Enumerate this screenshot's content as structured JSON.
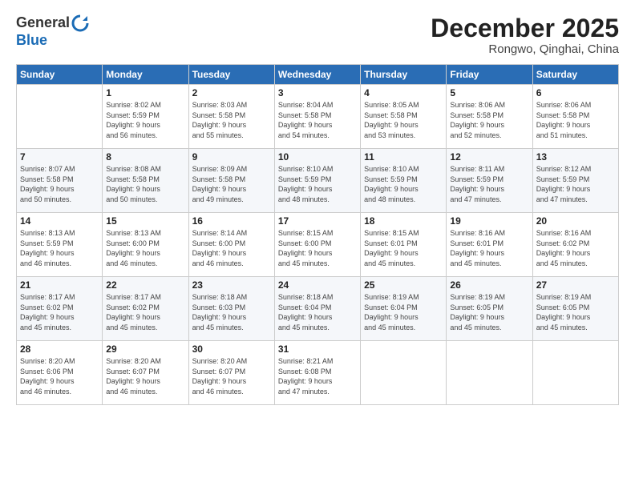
{
  "header": {
    "logo_line1": "General",
    "logo_line2": "Blue",
    "month": "December 2025",
    "location": "Rongwo, Qinghai, China"
  },
  "weekdays": [
    "Sunday",
    "Monday",
    "Tuesday",
    "Wednesday",
    "Thursday",
    "Friday",
    "Saturday"
  ],
  "weeks": [
    [
      {
        "day": "",
        "info": ""
      },
      {
        "day": "1",
        "info": "Sunrise: 8:02 AM\nSunset: 5:59 PM\nDaylight: 9 hours\nand 56 minutes."
      },
      {
        "day": "2",
        "info": "Sunrise: 8:03 AM\nSunset: 5:58 PM\nDaylight: 9 hours\nand 55 minutes."
      },
      {
        "day": "3",
        "info": "Sunrise: 8:04 AM\nSunset: 5:58 PM\nDaylight: 9 hours\nand 54 minutes."
      },
      {
        "day": "4",
        "info": "Sunrise: 8:05 AM\nSunset: 5:58 PM\nDaylight: 9 hours\nand 53 minutes."
      },
      {
        "day": "5",
        "info": "Sunrise: 8:06 AM\nSunset: 5:58 PM\nDaylight: 9 hours\nand 52 minutes."
      },
      {
        "day": "6",
        "info": "Sunrise: 8:06 AM\nSunset: 5:58 PM\nDaylight: 9 hours\nand 51 minutes."
      }
    ],
    [
      {
        "day": "7",
        "info": "Sunrise: 8:07 AM\nSunset: 5:58 PM\nDaylight: 9 hours\nand 50 minutes."
      },
      {
        "day": "8",
        "info": "Sunrise: 8:08 AM\nSunset: 5:58 PM\nDaylight: 9 hours\nand 50 minutes."
      },
      {
        "day": "9",
        "info": "Sunrise: 8:09 AM\nSunset: 5:58 PM\nDaylight: 9 hours\nand 49 minutes."
      },
      {
        "day": "10",
        "info": "Sunrise: 8:10 AM\nSunset: 5:59 PM\nDaylight: 9 hours\nand 48 minutes."
      },
      {
        "day": "11",
        "info": "Sunrise: 8:10 AM\nSunset: 5:59 PM\nDaylight: 9 hours\nand 48 minutes."
      },
      {
        "day": "12",
        "info": "Sunrise: 8:11 AM\nSunset: 5:59 PM\nDaylight: 9 hours\nand 47 minutes."
      },
      {
        "day": "13",
        "info": "Sunrise: 8:12 AM\nSunset: 5:59 PM\nDaylight: 9 hours\nand 47 minutes."
      }
    ],
    [
      {
        "day": "14",
        "info": "Sunrise: 8:13 AM\nSunset: 5:59 PM\nDaylight: 9 hours\nand 46 minutes."
      },
      {
        "day": "15",
        "info": "Sunrise: 8:13 AM\nSunset: 6:00 PM\nDaylight: 9 hours\nand 46 minutes."
      },
      {
        "day": "16",
        "info": "Sunrise: 8:14 AM\nSunset: 6:00 PM\nDaylight: 9 hours\nand 46 minutes."
      },
      {
        "day": "17",
        "info": "Sunrise: 8:15 AM\nSunset: 6:00 PM\nDaylight: 9 hours\nand 45 minutes."
      },
      {
        "day": "18",
        "info": "Sunrise: 8:15 AM\nSunset: 6:01 PM\nDaylight: 9 hours\nand 45 minutes."
      },
      {
        "day": "19",
        "info": "Sunrise: 8:16 AM\nSunset: 6:01 PM\nDaylight: 9 hours\nand 45 minutes."
      },
      {
        "day": "20",
        "info": "Sunrise: 8:16 AM\nSunset: 6:02 PM\nDaylight: 9 hours\nand 45 minutes."
      }
    ],
    [
      {
        "day": "21",
        "info": "Sunrise: 8:17 AM\nSunset: 6:02 PM\nDaylight: 9 hours\nand 45 minutes."
      },
      {
        "day": "22",
        "info": "Sunrise: 8:17 AM\nSunset: 6:02 PM\nDaylight: 9 hours\nand 45 minutes."
      },
      {
        "day": "23",
        "info": "Sunrise: 8:18 AM\nSunset: 6:03 PM\nDaylight: 9 hours\nand 45 minutes."
      },
      {
        "day": "24",
        "info": "Sunrise: 8:18 AM\nSunset: 6:04 PM\nDaylight: 9 hours\nand 45 minutes."
      },
      {
        "day": "25",
        "info": "Sunrise: 8:19 AM\nSunset: 6:04 PM\nDaylight: 9 hours\nand 45 minutes."
      },
      {
        "day": "26",
        "info": "Sunrise: 8:19 AM\nSunset: 6:05 PM\nDaylight: 9 hours\nand 45 minutes."
      },
      {
        "day": "27",
        "info": "Sunrise: 8:19 AM\nSunset: 6:05 PM\nDaylight: 9 hours\nand 45 minutes."
      }
    ],
    [
      {
        "day": "28",
        "info": "Sunrise: 8:20 AM\nSunset: 6:06 PM\nDaylight: 9 hours\nand 46 minutes."
      },
      {
        "day": "29",
        "info": "Sunrise: 8:20 AM\nSunset: 6:07 PM\nDaylight: 9 hours\nand 46 minutes."
      },
      {
        "day": "30",
        "info": "Sunrise: 8:20 AM\nSunset: 6:07 PM\nDaylight: 9 hours\nand 46 minutes."
      },
      {
        "day": "31",
        "info": "Sunrise: 8:21 AM\nSunset: 6:08 PM\nDaylight: 9 hours\nand 47 minutes."
      },
      {
        "day": "",
        "info": ""
      },
      {
        "day": "",
        "info": ""
      },
      {
        "day": "",
        "info": ""
      }
    ]
  ]
}
